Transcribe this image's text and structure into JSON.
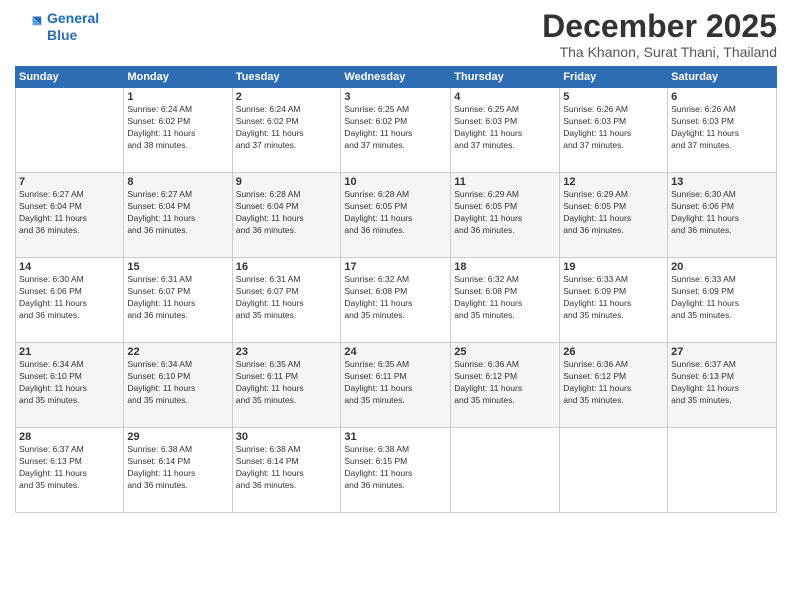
{
  "header": {
    "logo_line1": "General",
    "logo_line2": "Blue",
    "month": "December 2025",
    "location": "Tha Khanon, Surat Thani, Thailand"
  },
  "weekdays": [
    "Sunday",
    "Monday",
    "Tuesday",
    "Wednesday",
    "Thursday",
    "Friday",
    "Saturday"
  ],
  "weeks": [
    [
      {
        "day": "",
        "info": ""
      },
      {
        "day": "1",
        "info": "Sunrise: 6:24 AM\nSunset: 6:02 PM\nDaylight: 11 hours\nand 38 minutes."
      },
      {
        "day": "2",
        "info": "Sunrise: 6:24 AM\nSunset: 6:02 PM\nDaylight: 11 hours\nand 37 minutes."
      },
      {
        "day": "3",
        "info": "Sunrise: 6:25 AM\nSunset: 6:02 PM\nDaylight: 11 hours\nand 37 minutes."
      },
      {
        "day": "4",
        "info": "Sunrise: 6:25 AM\nSunset: 6:03 PM\nDaylight: 11 hours\nand 37 minutes."
      },
      {
        "day": "5",
        "info": "Sunrise: 6:26 AM\nSunset: 6:03 PM\nDaylight: 11 hours\nand 37 minutes."
      },
      {
        "day": "6",
        "info": "Sunrise: 6:26 AM\nSunset: 6:03 PM\nDaylight: 11 hours\nand 37 minutes."
      }
    ],
    [
      {
        "day": "7",
        "info": "Sunrise: 6:27 AM\nSunset: 6:04 PM\nDaylight: 11 hours\nand 36 minutes."
      },
      {
        "day": "8",
        "info": "Sunrise: 6:27 AM\nSunset: 6:04 PM\nDaylight: 11 hours\nand 36 minutes."
      },
      {
        "day": "9",
        "info": "Sunrise: 6:28 AM\nSunset: 6:04 PM\nDaylight: 11 hours\nand 36 minutes."
      },
      {
        "day": "10",
        "info": "Sunrise: 6:28 AM\nSunset: 6:05 PM\nDaylight: 11 hours\nand 36 minutes."
      },
      {
        "day": "11",
        "info": "Sunrise: 6:29 AM\nSunset: 6:05 PM\nDaylight: 11 hours\nand 36 minutes."
      },
      {
        "day": "12",
        "info": "Sunrise: 6:29 AM\nSunset: 6:05 PM\nDaylight: 11 hours\nand 36 minutes."
      },
      {
        "day": "13",
        "info": "Sunrise: 6:30 AM\nSunset: 6:06 PM\nDaylight: 11 hours\nand 36 minutes."
      }
    ],
    [
      {
        "day": "14",
        "info": "Sunrise: 6:30 AM\nSunset: 6:06 PM\nDaylight: 11 hours\nand 36 minutes."
      },
      {
        "day": "15",
        "info": "Sunrise: 6:31 AM\nSunset: 6:07 PM\nDaylight: 11 hours\nand 36 minutes."
      },
      {
        "day": "16",
        "info": "Sunrise: 6:31 AM\nSunset: 6:07 PM\nDaylight: 11 hours\nand 35 minutes."
      },
      {
        "day": "17",
        "info": "Sunrise: 6:32 AM\nSunset: 6:08 PM\nDaylight: 11 hours\nand 35 minutes."
      },
      {
        "day": "18",
        "info": "Sunrise: 6:32 AM\nSunset: 6:08 PM\nDaylight: 11 hours\nand 35 minutes."
      },
      {
        "day": "19",
        "info": "Sunrise: 6:33 AM\nSunset: 6:09 PM\nDaylight: 11 hours\nand 35 minutes."
      },
      {
        "day": "20",
        "info": "Sunrise: 6:33 AM\nSunset: 6:09 PM\nDaylight: 11 hours\nand 35 minutes."
      }
    ],
    [
      {
        "day": "21",
        "info": "Sunrise: 6:34 AM\nSunset: 6:10 PM\nDaylight: 11 hours\nand 35 minutes."
      },
      {
        "day": "22",
        "info": "Sunrise: 6:34 AM\nSunset: 6:10 PM\nDaylight: 11 hours\nand 35 minutes."
      },
      {
        "day": "23",
        "info": "Sunrise: 6:35 AM\nSunset: 6:11 PM\nDaylight: 11 hours\nand 35 minutes."
      },
      {
        "day": "24",
        "info": "Sunrise: 6:35 AM\nSunset: 6:11 PM\nDaylight: 11 hours\nand 35 minutes."
      },
      {
        "day": "25",
        "info": "Sunrise: 6:36 AM\nSunset: 6:12 PM\nDaylight: 11 hours\nand 35 minutes."
      },
      {
        "day": "26",
        "info": "Sunrise: 6:36 AM\nSunset: 6:12 PM\nDaylight: 11 hours\nand 35 minutes."
      },
      {
        "day": "27",
        "info": "Sunrise: 6:37 AM\nSunset: 6:13 PM\nDaylight: 11 hours\nand 35 minutes."
      }
    ],
    [
      {
        "day": "28",
        "info": "Sunrise: 6:37 AM\nSunset: 6:13 PM\nDaylight: 11 hours\nand 35 minutes."
      },
      {
        "day": "29",
        "info": "Sunrise: 6:38 AM\nSunset: 6:14 PM\nDaylight: 11 hours\nand 36 minutes."
      },
      {
        "day": "30",
        "info": "Sunrise: 6:38 AM\nSunset: 6:14 PM\nDaylight: 11 hours\nand 36 minutes."
      },
      {
        "day": "31",
        "info": "Sunrise: 6:38 AM\nSunset: 6:15 PM\nDaylight: 11 hours\nand 36 minutes."
      },
      {
        "day": "",
        "info": ""
      },
      {
        "day": "",
        "info": ""
      },
      {
        "day": "",
        "info": ""
      }
    ]
  ]
}
